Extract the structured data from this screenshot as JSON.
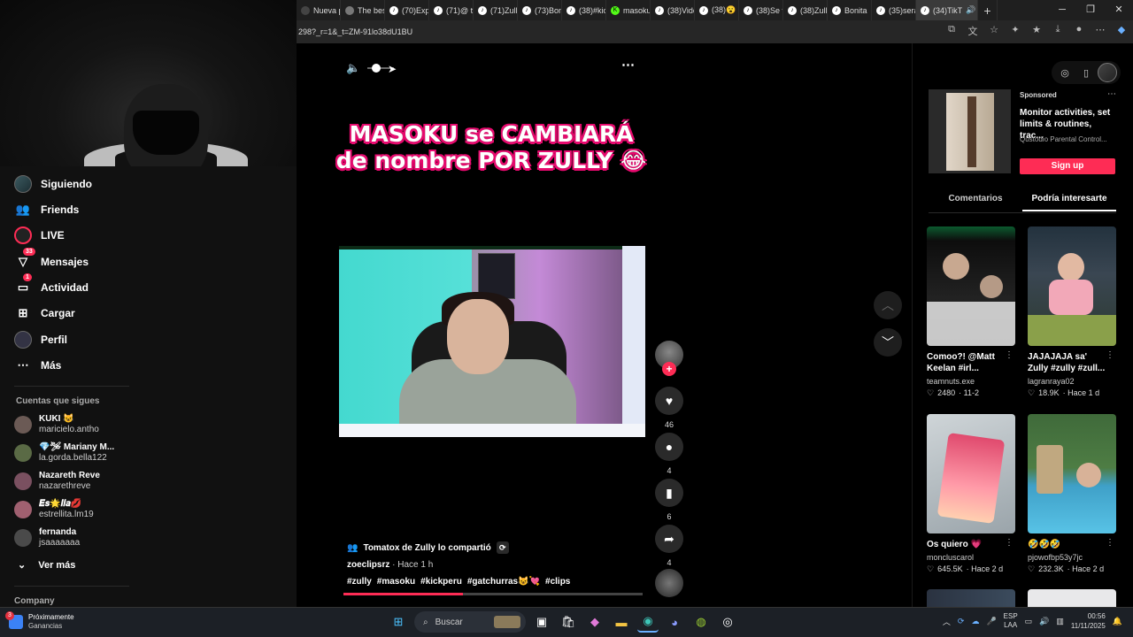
{
  "browser": {
    "tabs": [
      {
        "label": "Nueva p",
        "icon": "page-icon"
      },
      {
        "label": "The bes",
        "icon": "page-icon"
      },
      {
        "label": "(70)Expl",
        "icon": "tiktok-icon"
      },
      {
        "label": "(71)@ the",
        "icon": "tiktok-icon"
      },
      {
        "label": "(71)Zully",
        "icon": "tiktok-icon"
      },
      {
        "label": "(73)Bonit",
        "icon": "tiktok-icon"
      },
      {
        "label": "(38)#kick",
        "icon": "tiktok-icon"
      },
      {
        "label": "masoku",
        "icon": "kick-icon"
      },
      {
        "label": "(38)Vide",
        "icon": "tiktok-icon"
      },
      {
        "label": "(38)😮",
        "icon": "tiktok-icon"
      },
      {
        "label": "(38)Se v",
        "icon": "tiktok-icon"
      },
      {
        "label": "(38)Zully",
        "icon": "tiktok-icon"
      },
      {
        "label": "Bonita",
        "icon": "tiktok-icon"
      },
      {
        "label": "(35)sera",
        "icon": "tiktok-icon"
      },
      {
        "label": "(34)TikT",
        "icon": "tiktok-icon"
      }
    ],
    "url": "298?_r=1&_t=ZM-91lo38dU1BU"
  },
  "sidebar": {
    "nav": [
      {
        "label": "Siguiendo",
        "icon": "following-avatar-icon"
      },
      {
        "label": "Friends",
        "icon": "friends-icon"
      },
      {
        "label": "LIVE",
        "icon": "live-icon"
      },
      {
        "label": "Mensajes",
        "icon": "messages-icon",
        "badge": "33"
      },
      {
        "label": "Actividad",
        "icon": "activity-icon",
        "badge": "1"
      },
      {
        "label": "Cargar",
        "icon": "upload-icon"
      },
      {
        "label": "Perfil",
        "icon": "profile-icon"
      },
      {
        "label": "Más",
        "icon": "more-icon"
      }
    ],
    "following_title": "Cuentas que sigues",
    "following": [
      {
        "name": "KUKI 😺",
        "handle": "maricielo.antho"
      },
      {
        "name": "💎🛩 Mariany M...",
        "handle": "la.gorda.bella122"
      },
      {
        "name": "Nazareth Reve",
        "handle": "nazarethreve"
      },
      {
        "name": "𝑬𝒔🌟𝒍𝒍𝒂💋",
        "handle": "estrellita.lm19"
      },
      {
        "name": "fernanda",
        "handle": "jsaaaaaaa"
      }
    ],
    "see_more": "Ver más",
    "company": "Company"
  },
  "video": {
    "caption_line1": "MASOKU se CAMBIARÁ",
    "caption_line2": "de nombre POR ZULLY 😂",
    "likes": "46",
    "comments": "4",
    "saves": "6",
    "shares": "4",
    "shared_by": "Tomatox de Zully lo compartió",
    "author": "zoeclipsrz",
    "time": "· Hace 1 h",
    "hashtags": [
      "#zully",
      "#masoku",
      "#kickperu",
      "#gatchurras😺💘",
      "#clips"
    ],
    "progress": 0.4
  },
  "right_panel": {
    "ad": {
      "sponsored": "Sponsored",
      "title": "Monitor activities, set limits & routines, trac...",
      "brand": "Qustodio Parental Control...",
      "cta": "Sign up"
    },
    "tabs": [
      "Comentarios",
      "Podría interesarte"
    ],
    "cards": [
      {
        "title": "Comoo?! @Matt Keelan #irl...",
        "user": "teamnuts.exe",
        "likes": "2480",
        "when": "· 11-2"
      },
      {
        "title": "JAJAJAJA sa' Zully #zully #zull...",
        "user": "lagranraya02",
        "likes": "18.9K",
        "when": "· Hace 1 d"
      },
      {
        "title": "Os quiero 💗",
        "user": "moncluscarol",
        "likes": "645.5K",
        "when": "· Hace 2 d"
      },
      {
        "title": "🤣🤣🤣",
        "user": "pjowofbp53y7jc",
        "likes": "232.3K",
        "when": "· Hace 2 d"
      }
    ]
  },
  "taskbar": {
    "weather_line1": "Próximamente",
    "weather_line2": "Ganancias",
    "weather_badge": "3",
    "search": "Buscar",
    "lang1": "ESP",
    "lang2": "LAA",
    "time": "00:56",
    "date": "11/11/2025"
  },
  "colors": {
    "accent": "#fe2c55",
    "caption_outline": "#e60a6e"
  }
}
